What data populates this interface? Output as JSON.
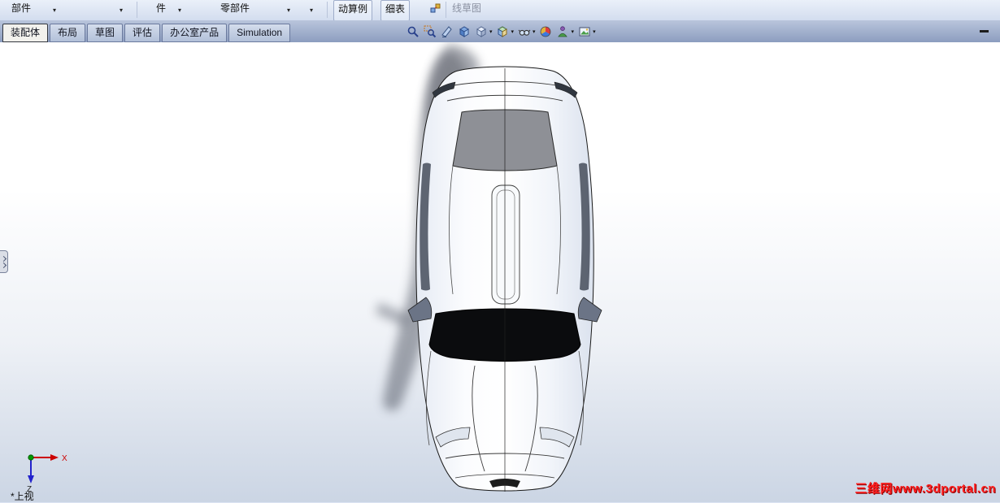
{
  "glyphs": {
    "dropdown_arrow": "▾"
  },
  "ribbon": {
    "partial_buttons": [
      {
        "label": "部件"
      },
      {
        "label": "件"
      },
      {
        "label": "零部件"
      },
      {
        "label": "动算例"
      },
      {
        "label": "细表"
      },
      {
        "label": "线草图",
        "disabled": true
      }
    ]
  },
  "tab_bar": {
    "tabs": [
      {
        "label": "装配体",
        "active": true
      },
      {
        "label": "布局",
        "active": false
      },
      {
        "label": "草图",
        "active": false
      },
      {
        "label": "评估",
        "active": false
      },
      {
        "label": "办公室产品",
        "active": false
      },
      {
        "label": "Simulation",
        "active": false
      }
    ]
  },
  "view_toolbar": {
    "icons": [
      {
        "name": "zoom-to-fit",
        "dropdown": false
      },
      {
        "name": "zoom-area",
        "dropdown": false
      },
      {
        "name": "section-view",
        "dropdown": false
      },
      {
        "name": "view-orientation",
        "dropdown": false
      },
      {
        "name": "display-style",
        "dropdown": true
      },
      {
        "name": "view-settings",
        "dropdown": true
      },
      {
        "name": "hide-show-items",
        "dropdown": true
      },
      {
        "name": "edit-appearance",
        "dropdown": false
      },
      {
        "name": "apply-scene",
        "dropdown": true
      },
      {
        "name": "camera-views",
        "dropdown": true
      }
    ]
  },
  "viewport": {
    "view_label": "*上视",
    "triad": {
      "x_label": "X",
      "z_label": "Z"
    },
    "watermark": "三维网www.3dportal.cn",
    "model": "car-assembly-top-view"
  },
  "colors": {
    "ribbon_bg": "#d9e2f1",
    "tabrow_bg": "#8c9dbf",
    "active_tab_bg": "#f2f1ed",
    "viewport_bottom": "#cbd5e4",
    "watermark_red": "#ff1e1e",
    "axis_x_red": "#cc0000",
    "axis_z_blue": "#2222cc",
    "axis_y_green": "#009900"
  }
}
